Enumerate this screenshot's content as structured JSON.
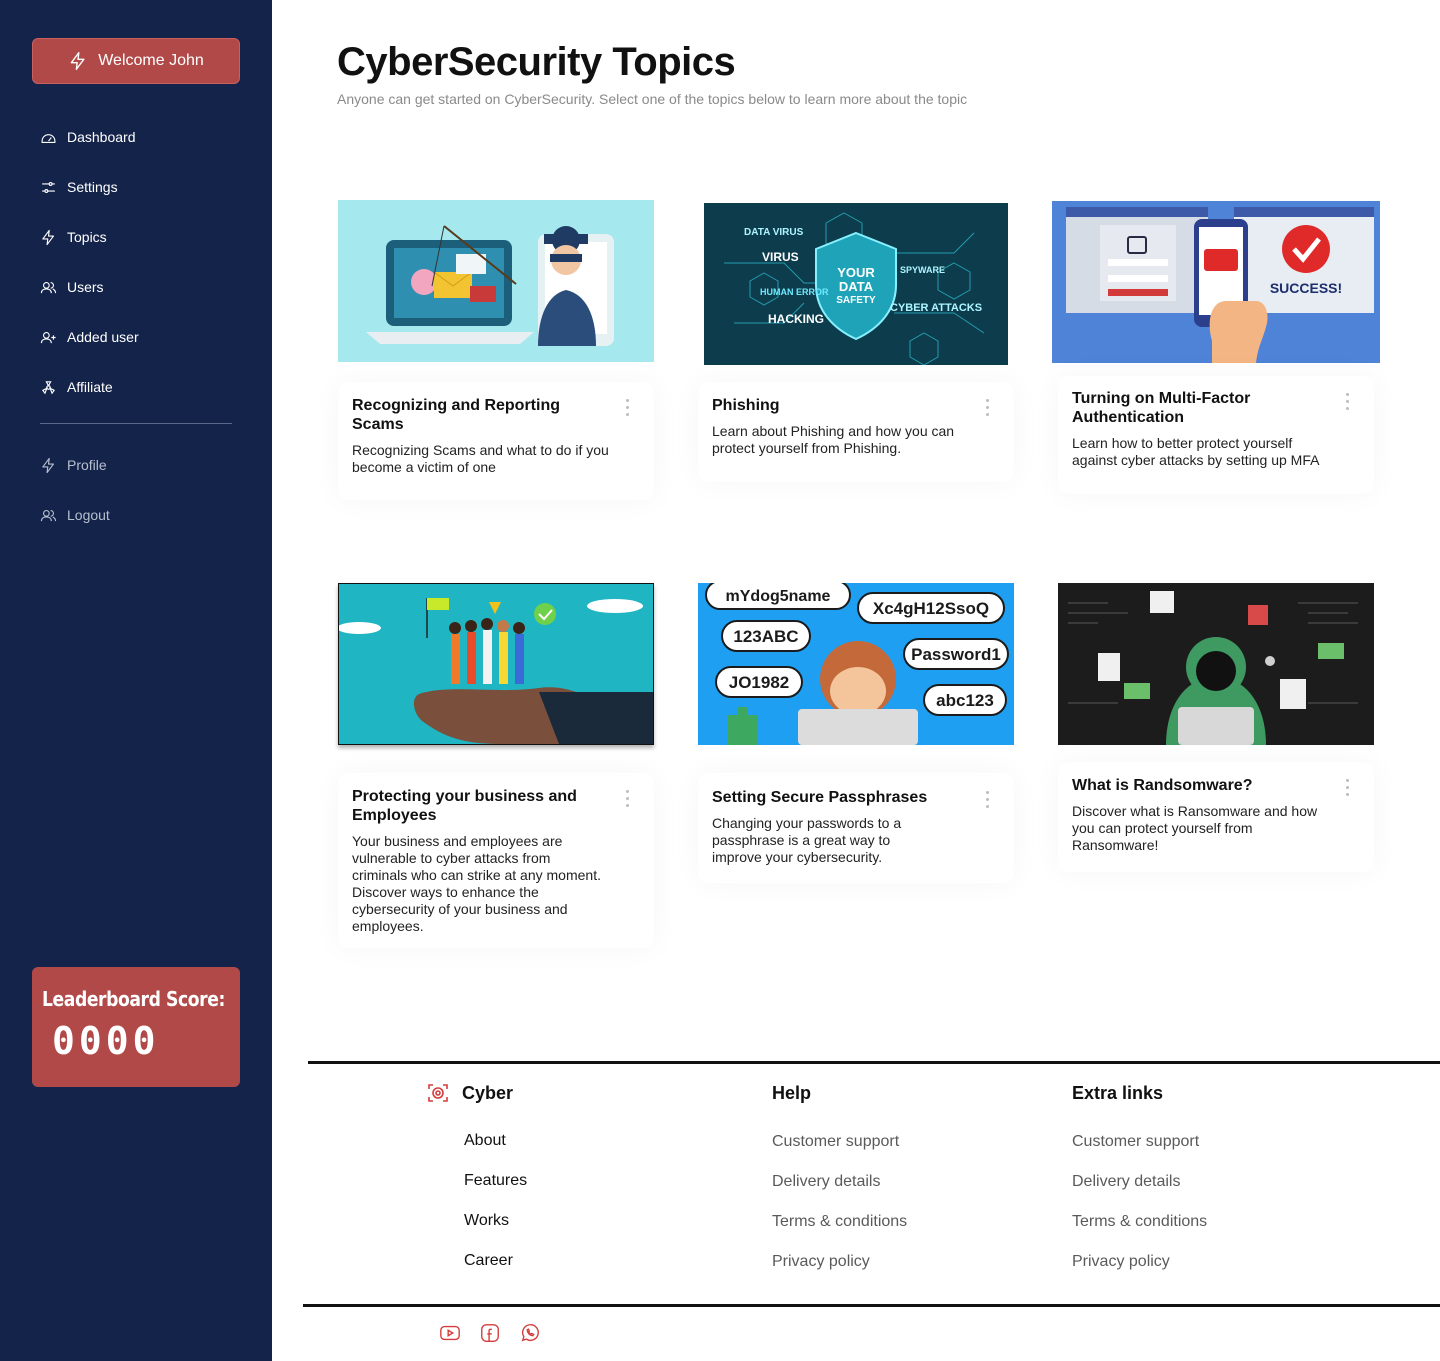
{
  "sidebar": {
    "welcome_label": "Welcome John",
    "nav": [
      {
        "label": "Dashboard",
        "icon": "dashboard-icon"
      },
      {
        "label": "Settings",
        "icon": "sliders-icon"
      },
      {
        "label": "Topics",
        "icon": "bolt-icon"
      },
      {
        "label": "Users",
        "icon": "users-icon"
      },
      {
        "label": "Added user",
        "icon": "user-plus-icon"
      },
      {
        "label": "Affiliate",
        "icon": "affiliate-icon"
      }
    ],
    "secondary": [
      {
        "label": "Profile",
        "icon": "bolt-icon"
      },
      {
        "label": "Logout",
        "icon": "users-icon"
      }
    ],
    "leaderboard": {
      "title": "Leaderboard Score:",
      "score": "0000"
    },
    "accent": "#b24949",
    "background": "#14234a"
  },
  "header": {
    "title": "CyberSecurity Topics",
    "subtitle": "Anyone can get started on CyberSecurity. Select one of the topics below to learn more about the topic"
  },
  "cards": [
    {
      "title": "Recognizing and Reporting Scams",
      "description": "Recognizing Scams and what to do if you become a victim of one"
    },
    {
      "title": "Phishing",
      "description": "Learn about Phishing and how you can protect yourself from Phishing."
    },
    {
      "title": "Turning on Multi-Factor Authentication",
      "description": "Learn how to better protect yourself against cyber attacks by setting up MFA"
    },
    {
      "title": "Protecting your business and Employees",
      "description": "Your business and employees are vulnerable to cyber attacks from criminals who can strike at any moment. Discover ways to enhance the cybersecurity of your business and employees."
    },
    {
      "title": "Setting Secure Passphrases",
      "description": "Changing your passwords to a passphrase is a great way to improve your cybersecurity."
    },
    {
      "title": "What is Randsomware?",
      "description": "Discover what is Ransomware and how you can protect yourself from Ransomware!"
    }
  ],
  "images": {
    "phishing": {
      "labels": [
        "DATA VIRUS",
        "VIRUS",
        "HUMAN ERROR",
        "HACKING",
        "SPYWARE",
        "CYBER ATTACKS"
      ],
      "shield": [
        "YOUR",
        "DATA",
        "SAFETY"
      ]
    },
    "mfa": {
      "success": "SUCCESS!"
    },
    "passphrases": [
      "mYdog5name",
      "Xc4gH12SsoQ",
      "123ABC",
      "Password1",
      "JO1982",
      "abc123"
    ]
  },
  "footer": {
    "brand": "Cyber",
    "brand_links": [
      "About",
      "Features",
      "Works",
      "Career"
    ],
    "help": {
      "title": "Help",
      "links": [
        "Customer support",
        "Delivery details",
        "Terms & conditions",
        "Privacy policy"
      ]
    },
    "extra": {
      "title": "Extra links",
      "links": [
        "Customer support",
        "Delivery details",
        "Terms & conditions",
        "Privacy policy"
      ]
    },
    "social": [
      "youtube-icon",
      "facebook-icon",
      "whatsapp-icon"
    ],
    "social_color": "#d53c3c"
  }
}
